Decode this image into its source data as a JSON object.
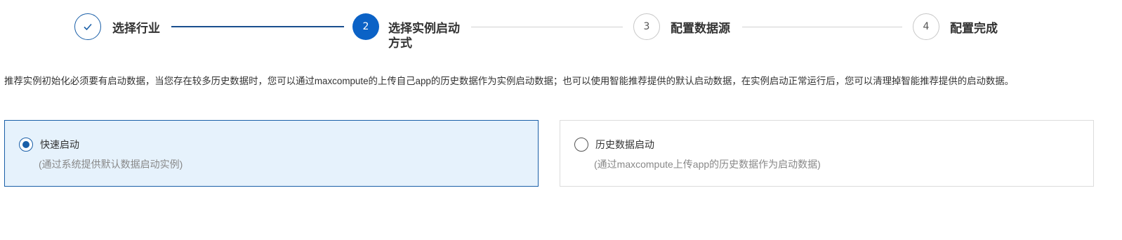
{
  "steps": [
    {
      "number": "1",
      "label": "选择行业",
      "status": "done",
      "icon": "check-icon"
    },
    {
      "number": "2",
      "label_line1": "选择实例启动",
      "label_line2": "方式",
      "status": "active"
    },
    {
      "number": "3",
      "label": "配置数据源",
      "status": "todo"
    },
    {
      "number": "4",
      "label": "配置完成",
      "status": "todo"
    }
  ],
  "description": "推荐实例初始化必须要有启动数据，当您存在较多历史数据时，您可以通过maxcompute的上传自己app的历史数据作为实例启动数据；也可以使用智能推荐提供的默认启动数据，在实例启动正常运行后，您可以清理掉智能推荐提供的启动数据。",
  "options": [
    {
      "title": "快速启动",
      "subtitle": "(通过系统提供默认数据启动实例)",
      "selected": true
    },
    {
      "title": "历史数据启动",
      "subtitle": "(通过maxcompute上传app的历史数据作为启动数据)",
      "selected": false
    }
  ],
  "colors": {
    "primary": "#0b62c6",
    "selected_border": "#1a5fa8",
    "selected_bg": "#e6f2fc",
    "inactive_line": "#d2d2d2"
  }
}
